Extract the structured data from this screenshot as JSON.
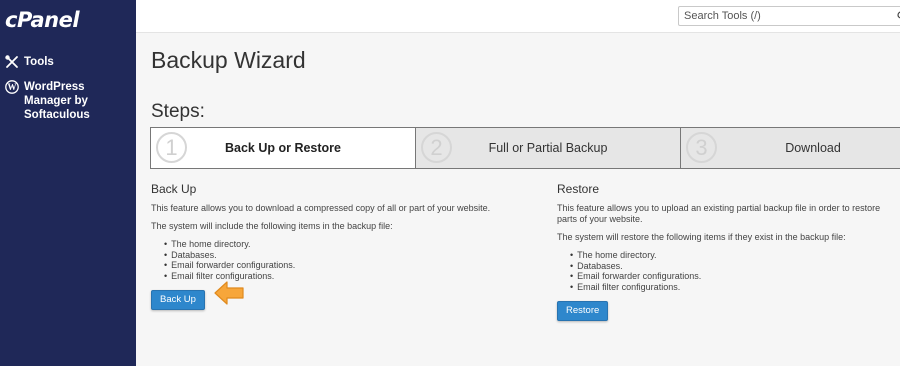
{
  "sidebar": {
    "logo": "cPanel",
    "items": [
      {
        "label": "Tools",
        "icon": "tools-icon"
      },
      {
        "label": "WordPress Manager by Softaculous",
        "icon": "wordpress-icon"
      }
    ]
  },
  "search": {
    "placeholder": "Search Tools (/)"
  },
  "page": {
    "title": "Backup Wizard",
    "steps_heading": "Steps:"
  },
  "steps": [
    {
      "number": "1",
      "label": "Back Up or Restore",
      "active": true
    },
    {
      "number": "2",
      "label": "Full or Partial Backup",
      "active": false
    },
    {
      "number": "3",
      "label": "Download",
      "active": false
    }
  ],
  "backup": {
    "heading": "Back Up",
    "description": "This feature allows you to download a compressed copy of all or part of your website.",
    "intro": "The system will include the following items in the backup file:",
    "items": [
      "The home directory.",
      "Databases.",
      "Email forwarder configurations.",
      "Email filter configurations."
    ],
    "button": "Back Up"
  },
  "restore": {
    "heading": "Restore",
    "description": "This feature allows you to upload an existing partial backup file in order to restore parts of your website.",
    "intro": "The system will restore the following items if they exist in the backup file:",
    "items": [
      "The home directory.",
      "Databases.",
      "Email forwarder configurations.",
      "Email filter configurations."
    ],
    "button": "Restore"
  },
  "colors": {
    "sidebar": "#1f2858",
    "button": "#2e87cc",
    "arrow": "#f7a63a"
  }
}
